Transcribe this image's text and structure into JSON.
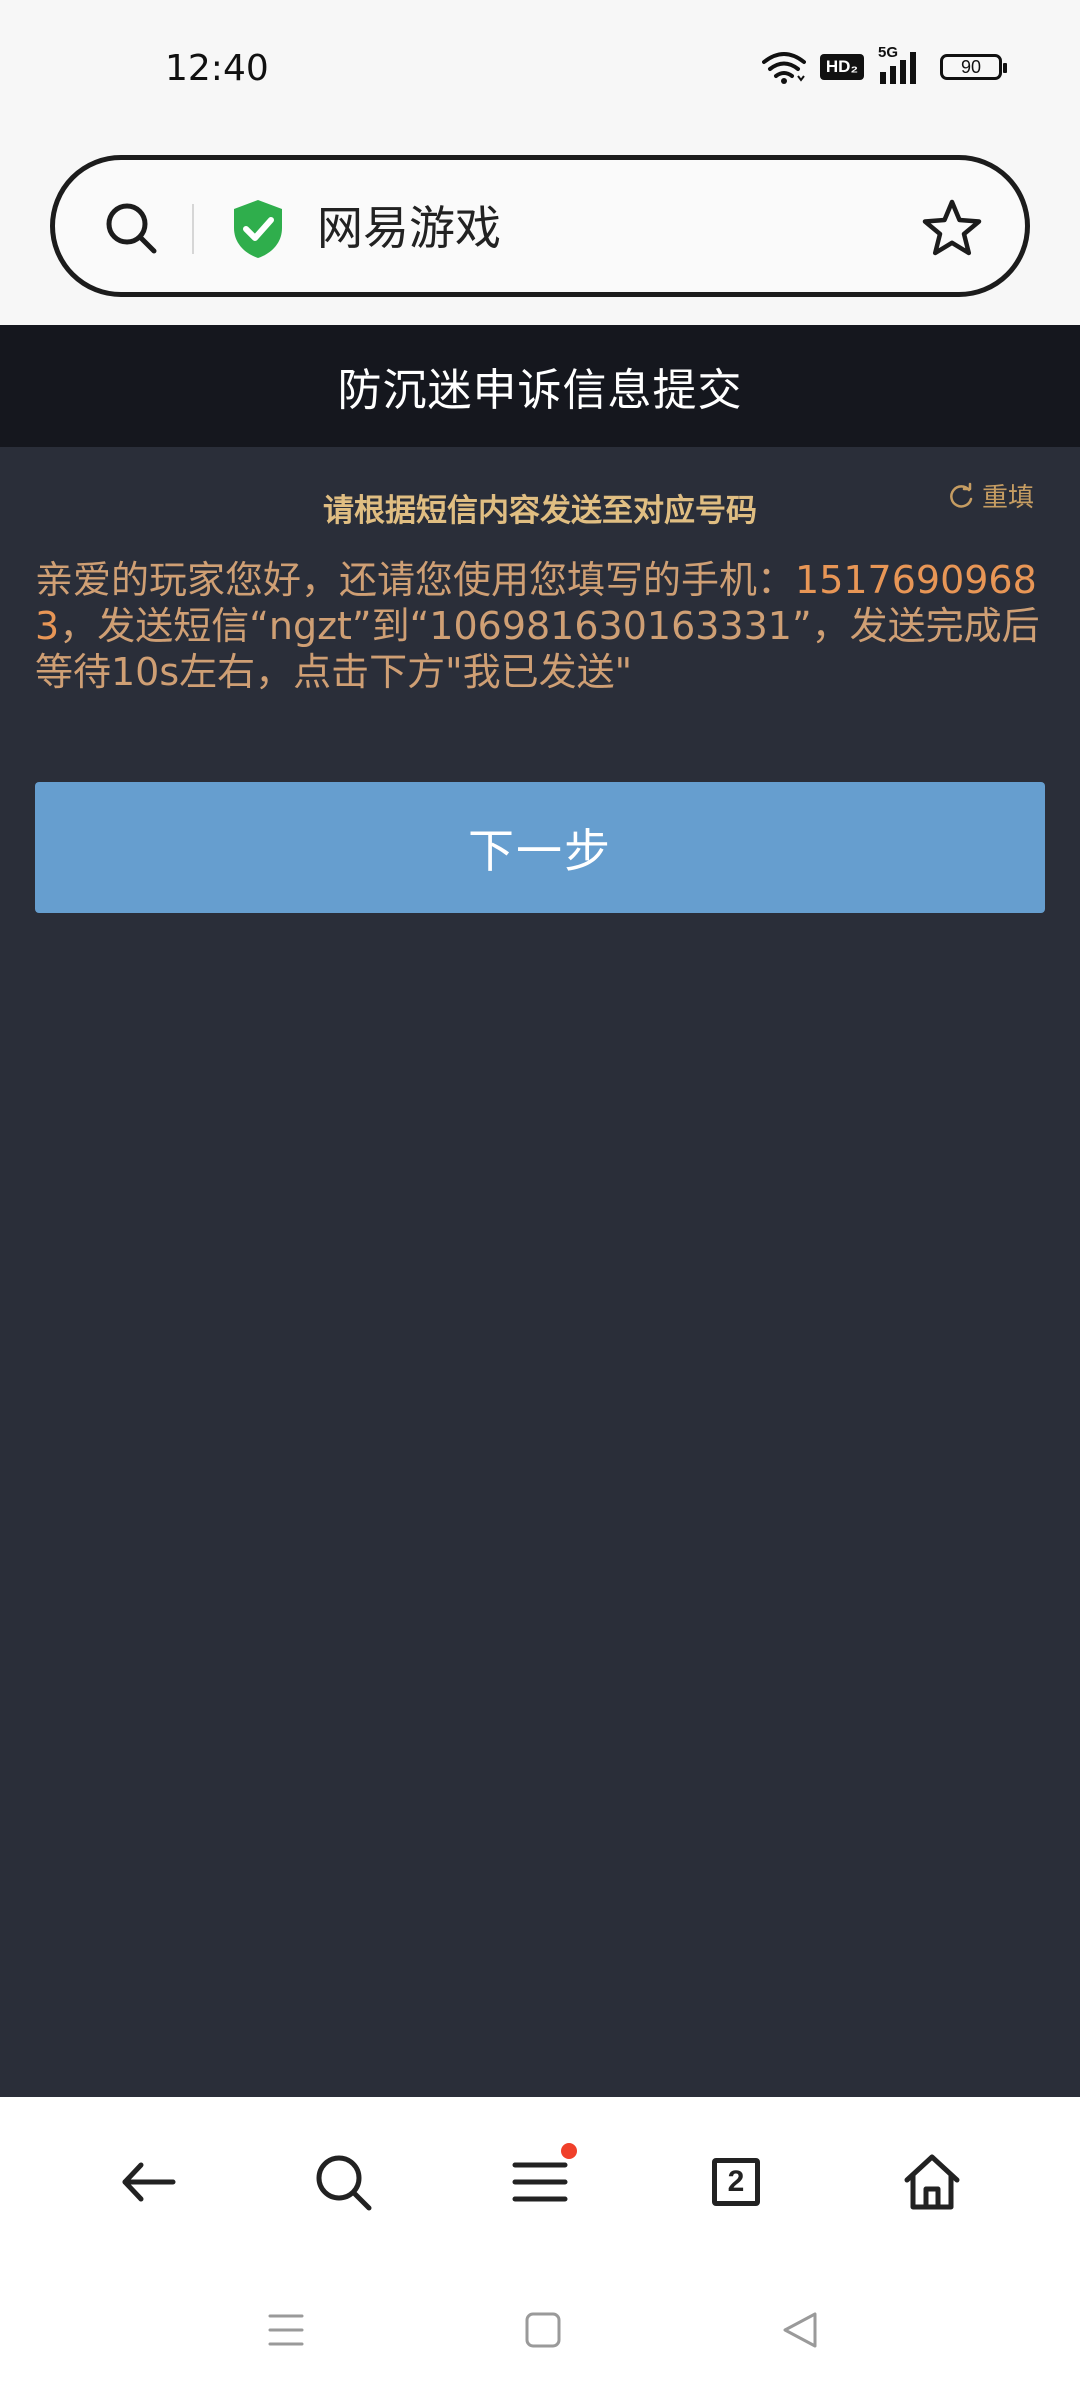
{
  "status_bar": {
    "time": "12:40",
    "network_badge": "HD₂",
    "network_type": "5G",
    "battery": "90"
  },
  "address_bar": {
    "site_name": "网易游戏",
    "icons": [
      "search-icon",
      "secure-shield-icon",
      "bookmark-star-icon"
    ]
  },
  "page": {
    "title": "防沉迷申诉信息提交",
    "subtitle": "请根据短信内容发送至对应号码",
    "refill_label": "重填",
    "message": {
      "part1": "亲爱的玩家您好，还请您使用您填写的手机：",
      "phone": "15176909683",
      "part2": "，发送短信“ngzt”到“106981630163331”，发送完成后等待10s左右，点击下方\"我已发送\""
    },
    "next_button": "下一步"
  },
  "toolbar": {
    "icons": [
      "back-arrow-icon",
      "search-icon",
      "menu-icon",
      "tabs-icon",
      "home-icon"
    ],
    "tab_count": "2",
    "menu_has_notification": true
  },
  "system_nav": {
    "icons": [
      "recent-apps-icon",
      "home-square-icon",
      "back-triangle-icon"
    ]
  },
  "colors": {
    "header_bg": "#15171e",
    "content_bg": "#2a2e39",
    "subtitle": "#e0be82",
    "message_text": "#cf9f74",
    "button_bg": "#669ecf",
    "notification_dot": "#f0402a",
    "shield_green": "#2fae4c"
  }
}
